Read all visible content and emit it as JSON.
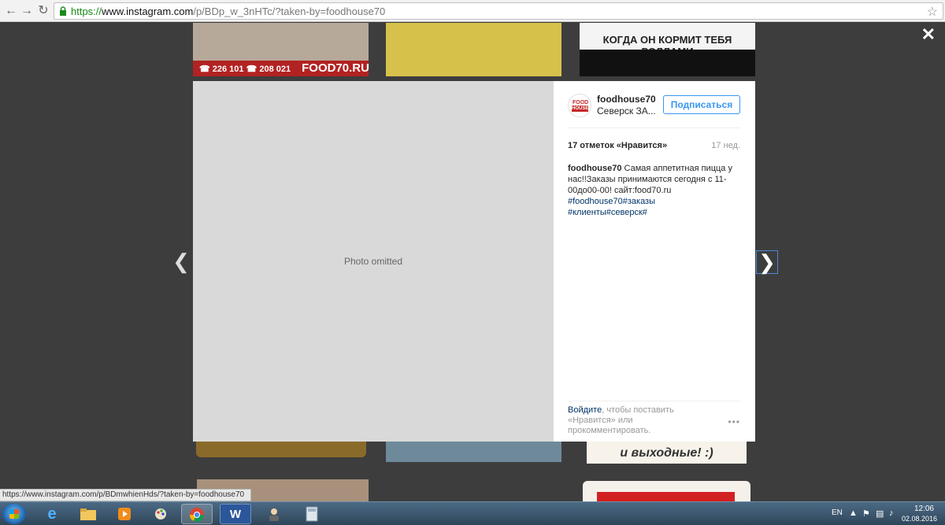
{
  "browser": {
    "url_scheme": "https://",
    "url_host": "www.instagram.com",
    "url_path": "/p/BDp_w_3nHTc/?taken-by=foodhouse70",
    "status_url": "https://www.instagram.com/p/BDmwhienHds/?taken-by=foodhouse70"
  },
  "background": {
    "tile1_phone": "☎ 226 101 ☎ 208 021",
    "tile1_site": "FOOD70.RU",
    "tile3_caption": "КОГДА ОН КОРМИТ ТЕБЯ РОЛЛАМИ",
    "tile6_text": "и выходные! :)"
  },
  "post": {
    "avatar_top": "FOOD",
    "avatar_bottom": "HOUSE",
    "username": "foodhouse70",
    "location": "Северск ЗА...",
    "follow_label": "Подписаться",
    "likes": "17 отметок «Нравится»",
    "age": "17 нед.",
    "caption_owner": "foodhouse70",
    "caption_text": " Самая аппетитная пицца у нас!!Заказы принимаются сегодня с 11-00до00-00! сайт:food70.ru",
    "tags_line1": "#foodhouse70#заказы",
    "tags_line2": "#клиенты#северск#",
    "login_link": "Войдите",
    "login_rest": ", чтобы поставить «Нравится» или прокомментировать.",
    "more_dots": "•••"
  },
  "taskbar": {
    "lang": "EN",
    "time": "12:06",
    "date": "02.08.2016"
  },
  "colors": {
    "accent": "#3897f0",
    "hashtag": "#003569"
  }
}
